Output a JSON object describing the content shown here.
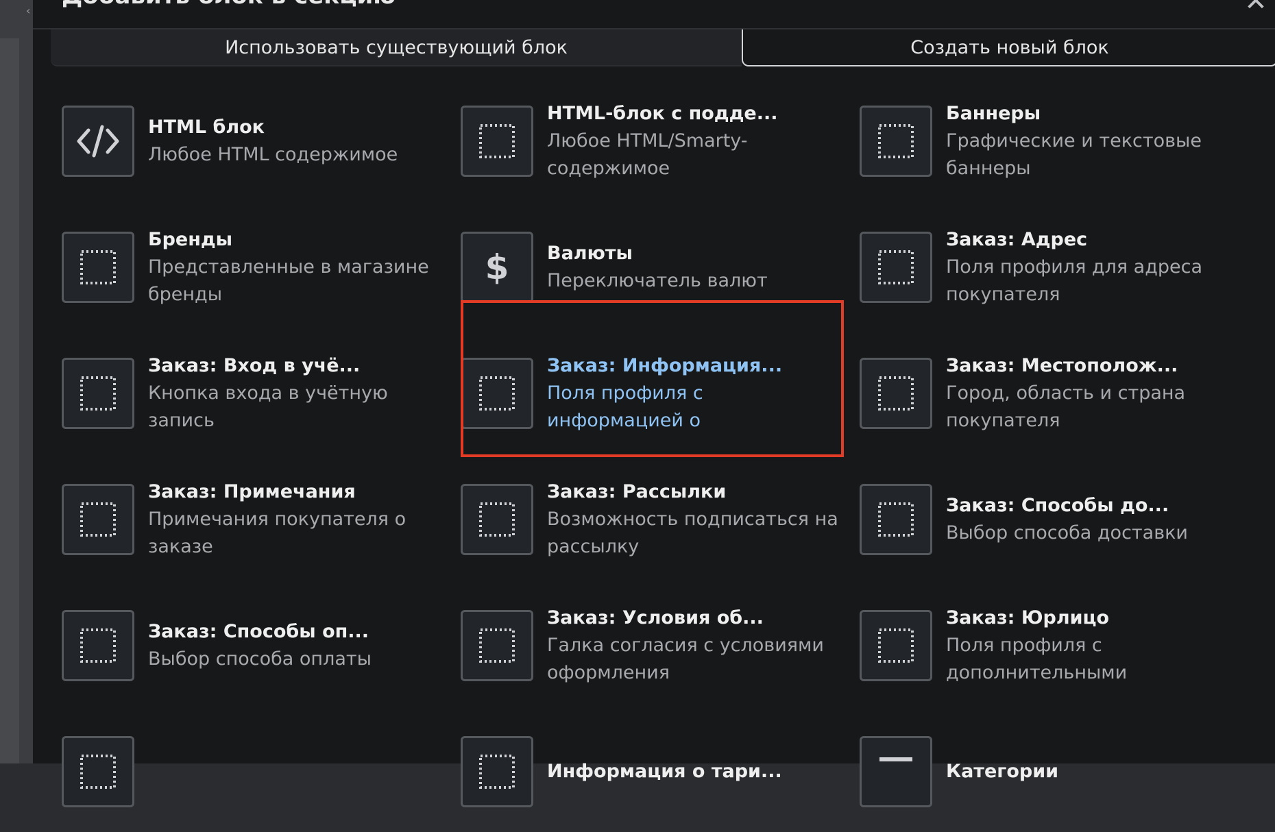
{
  "modal": {
    "title": "Добавить блок в секцию",
    "close_icon": "close-icon"
  },
  "tabs": {
    "existing": "Использовать существующий блок",
    "new": "Создать новый блок"
  },
  "blocks": [
    {
      "title": "HTML блок",
      "desc": "Любое HTML содержимое",
      "icon": "code-icon"
    },
    {
      "title": "HTML-блок с подде...",
      "desc": "Любое HTML/Smarty-содержимое",
      "icon": "dotted-square-icon"
    },
    {
      "title": "Баннеры",
      "desc": "Графические и текстовые баннеры",
      "icon": "dotted-square-icon"
    },
    {
      "title": "Бренды",
      "desc": "Представленные в магазине бренды",
      "icon": "dotted-square-icon"
    },
    {
      "title": "Валюты",
      "desc": "Переключатель валют",
      "icon": "dollar-icon"
    },
    {
      "title": "Заказ: Адрес",
      "desc": "Поля профиля для адреса покупателя",
      "icon": "dotted-square-icon"
    },
    {
      "title": "Заказ: Вход в учё...",
      "desc": "Кнопка входа в учётную запись",
      "icon": "dotted-square-icon"
    },
    {
      "title": "Заказ: Информация...",
      "desc": "Поля профиля с информацией о",
      "icon": "dotted-square-icon",
      "selected": true
    },
    {
      "title": "Заказ: Местополож...",
      "desc": "Город, область и страна покупателя",
      "icon": "dotted-square-icon"
    },
    {
      "title": "Заказ: Примечания",
      "desc": "Примечания покупателя о заказе",
      "icon": "dotted-square-icon"
    },
    {
      "title": "Заказ: Рассылки",
      "desc": "Возможность подписаться на рассылку",
      "icon": "dotted-square-icon"
    },
    {
      "title": "Заказ: Способы до...",
      "desc": "Выбор способа доставки",
      "icon": "dotted-square-icon"
    },
    {
      "title": "Заказ: Способы оп...",
      "desc": "Выбор способа оплаты",
      "icon": "dotted-square-icon"
    },
    {
      "title": "Заказ: Условия об...",
      "desc": "Галка согласия с условиями оформления",
      "icon": "dotted-square-icon"
    },
    {
      "title": "Заказ: Юрлицо",
      "desc": "Поля профиля с дополнительными",
      "icon": "dotted-square-icon"
    },
    {
      "title": "",
      "desc": "",
      "icon": "dotted-square-icon"
    },
    {
      "title": "Информация о тари...",
      "desc": "",
      "icon": "dotted-square-icon"
    },
    {
      "title": "Категории",
      "desc": "",
      "icon": "list-icon"
    }
  ]
}
